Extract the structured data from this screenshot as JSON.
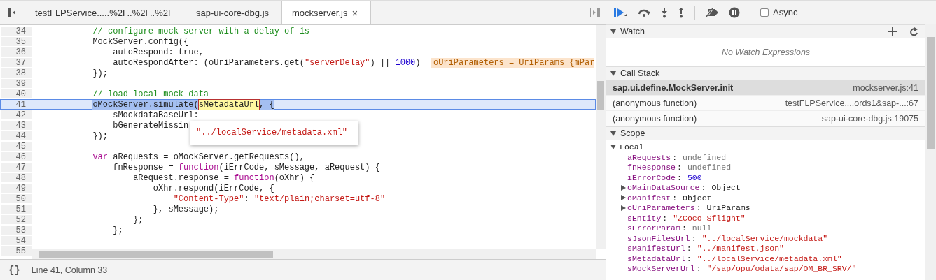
{
  "editor": {
    "tabs": [
      {
        "label": "testFLPService.....%2F..%2F..%2F",
        "selected": false
      },
      {
        "label": "sap-ui-core-dbg.js",
        "selected": false
      },
      {
        "label": "mockserver.js",
        "selected": true,
        "close": "×"
      }
    ],
    "lines": [
      {
        "number": "34",
        "selected": false,
        "tokens": [
          {
            "text": "            // configure mock server with a delay of 1s",
            "kind": "comment"
          }
        ]
      },
      {
        "number": "35",
        "selected": false,
        "tokens": [
          {
            "text": "            MockServer.config({",
            "kind": "plain"
          }
        ]
      },
      {
        "number": "36",
        "selected": false,
        "tokens": [
          {
            "text": "                autoRespond: true,",
            "kind": "plain"
          }
        ]
      },
      {
        "number": "37",
        "selected": false,
        "tokens": [
          {
            "text": "                autoRespondAfter: (oUriParameters.get(",
            "kind": "plain"
          },
          {
            "text": "\"serverDelay\"",
            "kind": "string"
          },
          {
            "text": ") || ",
            "kind": "plain"
          },
          {
            "text": "1000",
            "kind": "number"
          },
          {
            "text": ")  ",
            "kind": "plain"
          },
          {
            "text": "oUriParameters = UriParams {mPar",
            "kind": "inline_value"
          }
        ]
      },
      {
        "number": "38",
        "selected": false,
        "tokens": [
          {
            "text": "            });",
            "kind": "plain"
          }
        ]
      },
      {
        "number": "39",
        "selected": false
      },
      {
        "number": "40",
        "selected": false,
        "tokens": [
          {
            "text": "            // load local mock data",
            "kind": "comment"
          }
        ]
      },
      {
        "number": "41",
        "selected": true,
        "tokens": [
          {
            "text": "            oMockServer.simulate(",
            "kind": "selection"
          },
          {
            "text": "sMetadataUrl",
            "kind": "hover"
          },
          {
            "text": ", {",
            "kind": "selection"
          }
        ]
      },
      {
        "number": "42",
        "selected": false,
        "tokens": [
          {
            "text": "                sMockdataBaseUrl:",
            "kind": "plain"
          }
        ]
      },
      {
        "number": "43",
        "selected": false,
        "tokens": [
          {
            "text": "                bGenerateMissin",
            "kind": "plain"
          }
        ]
      },
      {
        "number": "44",
        "selected": false,
        "tokens": [
          {
            "text": "            });",
            "kind": "plain"
          }
        ]
      },
      {
        "number": "45",
        "selected": false
      },
      {
        "number": "46",
        "selected": false,
        "tokens": [
          {
            "text": "            var",
            "kind": "keyword"
          },
          {
            "text": " aRequests = oMockServer.getRequests(),",
            "kind": "plain"
          }
        ]
      },
      {
        "number": "47",
        "selected": false,
        "tokens": [
          {
            "text": "                fnResponse = ",
            "kind": "plain"
          },
          {
            "text": "function",
            "kind": "keyword"
          },
          {
            "text": "(iErrCode, sMessage, aRequest) {",
            "kind": "plain"
          }
        ]
      },
      {
        "number": "48",
        "selected": false,
        "tokens": [
          {
            "text": "                    aRequest.response = ",
            "kind": "plain"
          },
          {
            "text": "function",
            "kind": "keyword"
          },
          {
            "text": "(oXhr) {",
            "kind": "plain"
          }
        ]
      },
      {
        "number": "49",
        "selected": false,
        "tokens": [
          {
            "text": "                        oXhr.respond(iErrCode, {",
            "kind": "plain"
          }
        ]
      },
      {
        "number": "50",
        "selected": false,
        "tokens": [
          {
            "text": "                            \"Content-Type\"",
            "kind": "string"
          },
          {
            "text": ": ",
            "kind": "plain"
          },
          {
            "text": "\"text/plain;charset=utf-8\"",
            "kind": "string"
          }
        ]
      },
      {
        "number": "51",
        "selected": false,
        "tokens": [
          {
            "text": "                        }, sMessage);",
            "kind": "plain"
          }
        ]
      },
      {
        "number": "52",
        "selected": false,
        "tokens": [
          {
            "text": "                    };",
            "kind": "plain"
          }
        ]
      },
      {
        "number": "53",
        "selected": false,
        "tokens": [
          {
            "text": "                };",
            "kind": "plain"
          }
        ]
      },
      {
        "number": "54",
        "selected": false
      },
      {
        "number": "55",
        "selected": false
      }
    ],
    "tooltip": {
      "text": "\"../localService/metadata.xml\""
    },
    "status": {
      "format_icon": "{}",
      "position": "Line 41, Column 33"
    }
  },
  "debugger": {
    "async": {
      "label": "Async",
      "checked": false
    },
    "watch": {
      "title": "Watch",
      "expanded": true,
      "empty_text": "No Watch Expressions"
    },
    "call_stack": {
      "title": "Call Stack",
      "expanded": true,
      "frames": [
        {
          "function": "sap.ui.define.MockServer.init",
          "location": "mockserver.js:41",
          "selected": true
        },
        {
          "function": "(anonymous function)",
          "location": "testFLPService....ords1&sap-...:67",
          "selected": false
        },
        {
          "function": "(anonymous function)",
          "location": "sap-ui-core-dbg.js:19075",
          "selected": false
        }
      ]
    },
    "scope": {
      "title": "Scope",
      "expanded": true,
      "children": [
        {
          "name": "Local",
          "expanded": true,
          "children": [
            {
              "name": "aRequests",
              "separator": ":",
              "value": "undefined",
              "kind": "undefined",
              "expandable": false
            },
            {
              "name": "fnResponse",
              "separator": ":",
              "value": "undefined",
              "kind": "undefined",
              "expandable": false
            },
            {
              "name": "iErrorCode",
              "separator": ":",
              "value": "500",
              "kind": "number",
              "expandable": false
            },
            {
              "name": "oMainDataSource",
              "separator": ":",
              "value": "Object",
              "kind": "object",
              "expandable": true
            },
            {
              "name": "oManifest",
              "separator": ":",
              "value": "Object",
              "kind": "object",
              "expandable": true
            },
            {
              "name": "oUriParameters",
              "separator": ":",
              "value": "UriParams",
              "kind": "object",
              "expandable": true
            },
            {
              "name": "sEntity",
              "separator": ":",
              "value": "\"ZCoco Sflight\"",
              "kind": "string",
              "expandable": false
            },
            {
              "name": "sErrorParam",
              "separator": ":",
              "value": "null",
              "kind": "undefined",
              "expandable": false
            },
            {
              "name": "sJsonFilesUrl",
              "separator": ":",
              "value": "\"../localService/mockdata\"",
              "kind": "string",
              "expandable": false
            },
            {
              "name": "sManifestUrl",
              "separator": ":",
              "value": "\"../manifest.json\"",
              "kind": "string",
              "expandable": false
            },
            {
              "name": "sMetadataUrl",
              "separator": ":",
              "value": "\"../localService/metadata.xml\"",
              "kind": "string",
              "expandable": false
            },
            {
              "name": "sMockServerUrl",
              "separator": ":",
              "value": "\"/sap/opu/odata/sap/OM_BR_SRV/\"",
              "kind": "string",
              "expandable": false
            }
          ]
        }
      ]
    }
  }
}
